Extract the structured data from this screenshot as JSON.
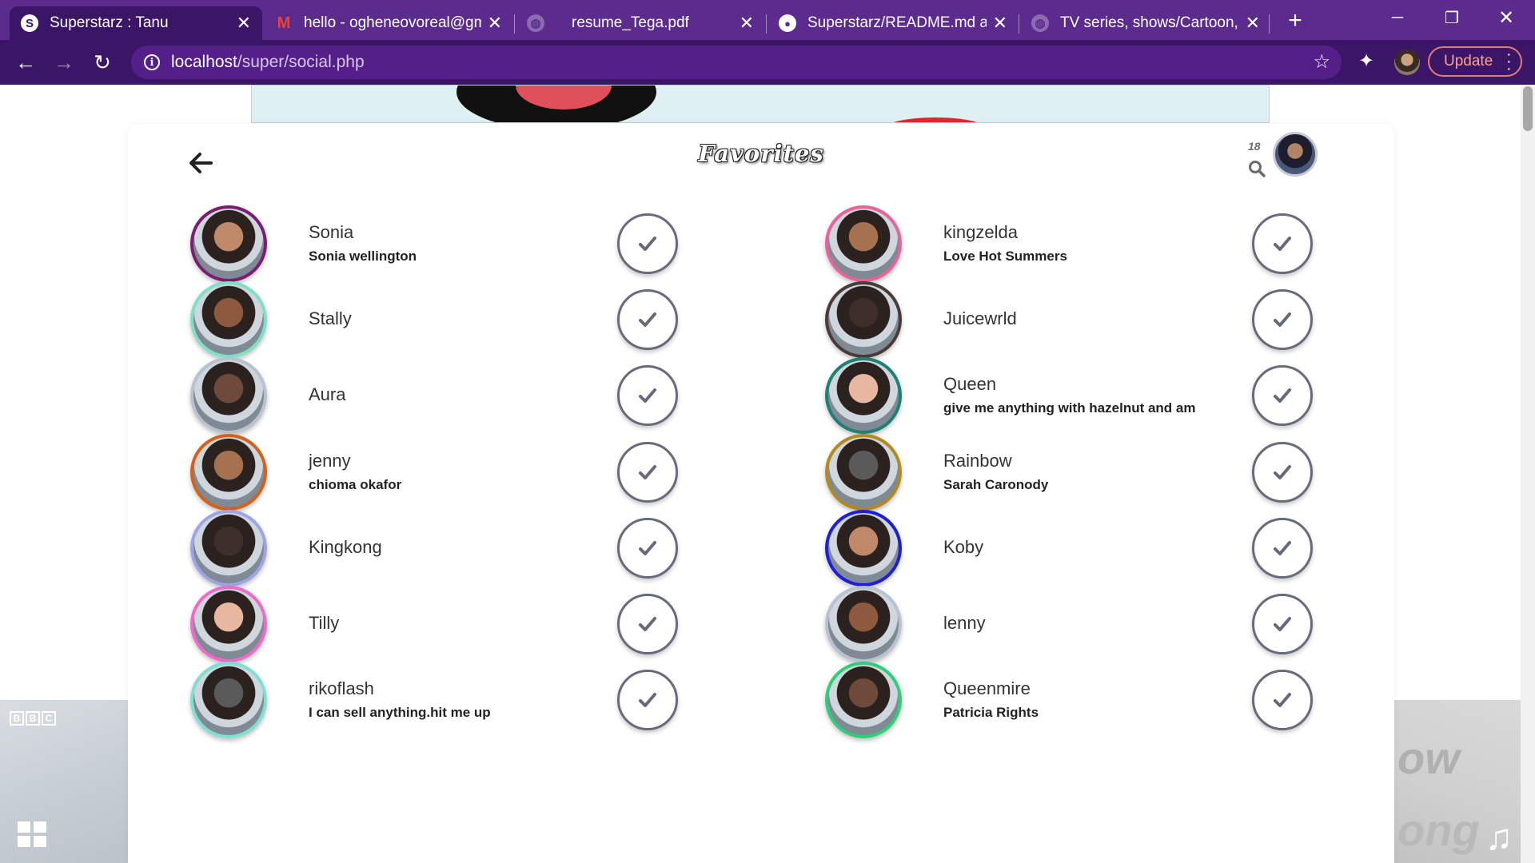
{
  "browser": {
    "tabs": [
      {
        "title": "Superstarz : Tanu",
        "active": true,
        "favicon": "superstarz-s-icon"
      },
      {
        "title": "hello - ogheneovoreal@gmail.com",
        "active": false,
        "favicon": "gmail-icon"
      },
      {
        "title": "resume_Tega.pdf",
        "active": false,
        "favicon": "globe-icon"
      },
      {
        "title": "Superstarz/README.md at main",
        "active": false,
        "favicon": "github-icon"
      },
      {
        "title": "TV series, shows/Cartoon, Anime",
        "active": false,
        "favicon": "globe-icon"
      }
    ],
    "address": {
      "host": "localhost",
      "path": "/super/social.php"
    },
    "update_label": "Update",
    "theme_color": "#3b1566"
  },
  "header": {
    "title": "Favorites",
    "count": "18"
  },
  "favorites_left": [
    {
      "username": "Sonia",
      "bio": "Sonia wellington",
      "ring_color": "#7a1e72"
    },
    {
      "username": "Stally",
      "bio": "",
      "ring_color": "#7fe0c6"
    },
    {
      "username": "Aura",
      "bio": "",
      "ring_color": "#b9c3cf"
    },
    {
      "username": "jenny",
      "bio": "chioma okafor",
      "ring_color": "#d2621c"
    },
    {
      "username": "Kingkong",
      "bio": "",
      "ring_color": "#9da5e8"
    },
    {
      "username": "Tilly",
      "bio": "",
      "ring_color": "#f06ac8"
    },
    {
      "username": "rikoflash",
      "bio": "I can sell anything.hit me up",
      "ring_color": "#7fe0d2"
    }
  ],
  "favorites_right": [
    {
      "username": "kingzelda",
      "bio": "Love Hot Summers",
      "ring_color": "#e9629a"
    },
    {
      "username": "Juicewrld",
      "bio": "",
      "ring_color": "#4a3a3a"
    },
    {
      "username": "Queen",
      "bio": "give me anything with hazelnut and am",
      "ring_color": "#1f7f73"
    },
    {
      "username": "Rainbow",
      "bio": "Sarah Caronody",
      "ring_color": "#b38a1f"
    },
    {
      "username": "Koby",
      "bio": "",
      "ring_color": "#1c1fd6"
    },
    {
      "username": "lenny",
      "bio": "",
      "ring_color": "#b9c3cf"
    },
    {
      "username": "Queenmire",
      "bio": "Patricia Rights",
      "ring_color": "#2fcf7a"
    }
  ],
  "background": {
    "left_badge": [
      "B",
      "B",
      "C"
    ],
    "right_text_1": "ow",
    "right_text_2": "ong"
  }
}
